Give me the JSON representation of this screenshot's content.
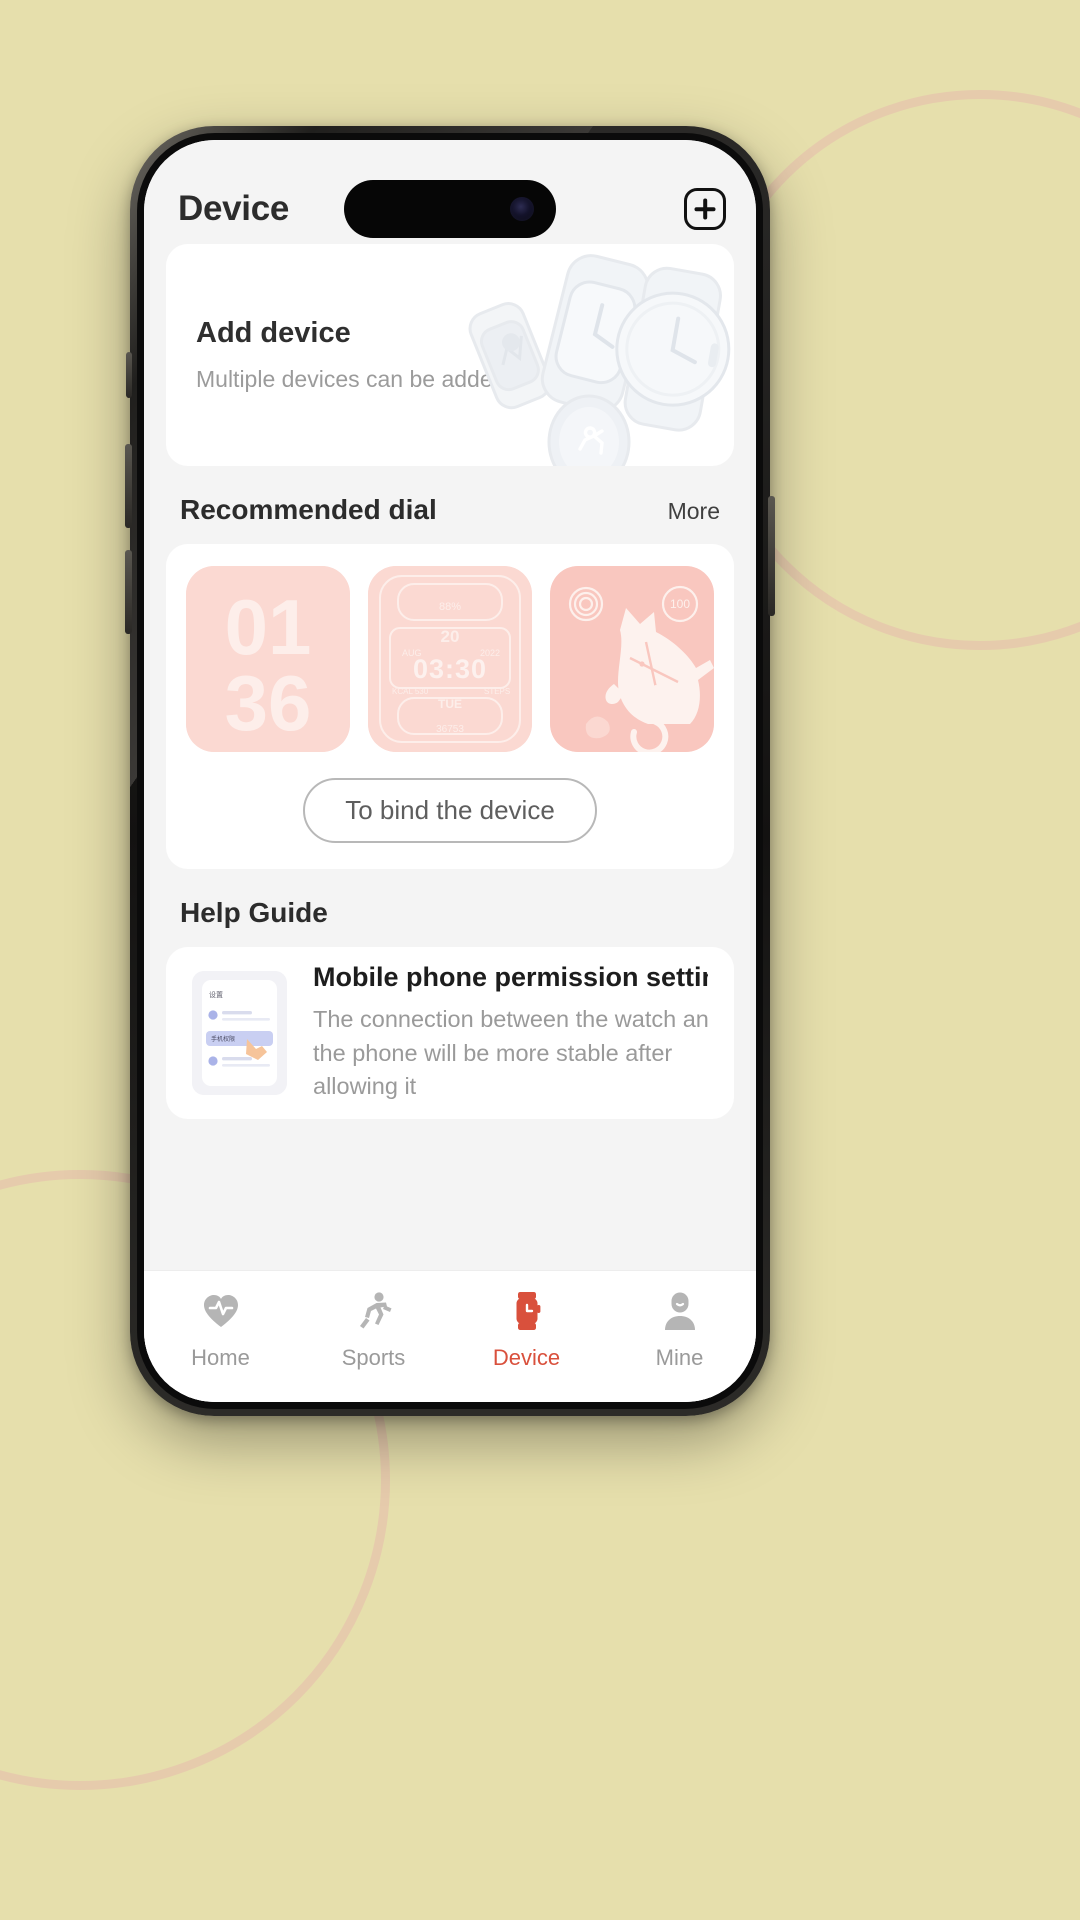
{
  "background": {
    "color": "#e6dfac",
    "deco_color": "#e6b9ad"
  },
  "device": {
    "frame": "iphone",
    "island": "dynamic-island"
  },
  "appbar": {
    "title": "Device",
    "add_button_icon": "plus-in-rounded-square"
  },
  "add_device_card": {
    "title": "Add device",
    "subtitle": "Multiple devices can be added",
    "art": "watches-illustration"
  },
  "recommended_dial": {
    "section_title": "Recommended dial",
    "more_label": "More",
    "dials": [
      {
        "name": "big-digits-dial",
        "line1": "01",
        "line2": "36"
      },
      {
        "name": "digital-data-dial",
        "time": "03:30",
        "day_num": "20",
        "month": "AUG",
        "year": "2022",
        "weekday": "TUE",
        "left_metric": "KCAL 530",
        "right_metric": "STEPS",
        "battery": "88%",
        "bottom_metric": "36753"
      },
      {
        "name": "horse-dial",
        "ring_value": "100"
      }
    ],
    "bind_button": "To bind the device"
  },
  "help_guide": {
    "section_title": "Help Guide",
    "item": {
      "title": "Mobile phone permission setting",
      "description": "The connection between the watch and the phone will be more stable after allowing it",
      "thumb_caption": "设置",
      "thumb_row_highlight": "手机权限"
    }
  },
  "tabbar": {
    "active_color": "#d9503c",
    "inactive_color": "#9a9a9a",
    "tabs": [
      {
        "label": "Home",
        "icon": "heart-pulse-icon",
        "active": false
      },
      {
        "label": "Sports",
        "icon": "runner-icon",
        "active": false
      },
      {
        "label": "Device",
        "icon": "smartwatch-icon",
        "active": true
      },
      {
        "label": "Mine",
        "icon": "person-icon",
        "active": false
      }
    ]
  }
}
